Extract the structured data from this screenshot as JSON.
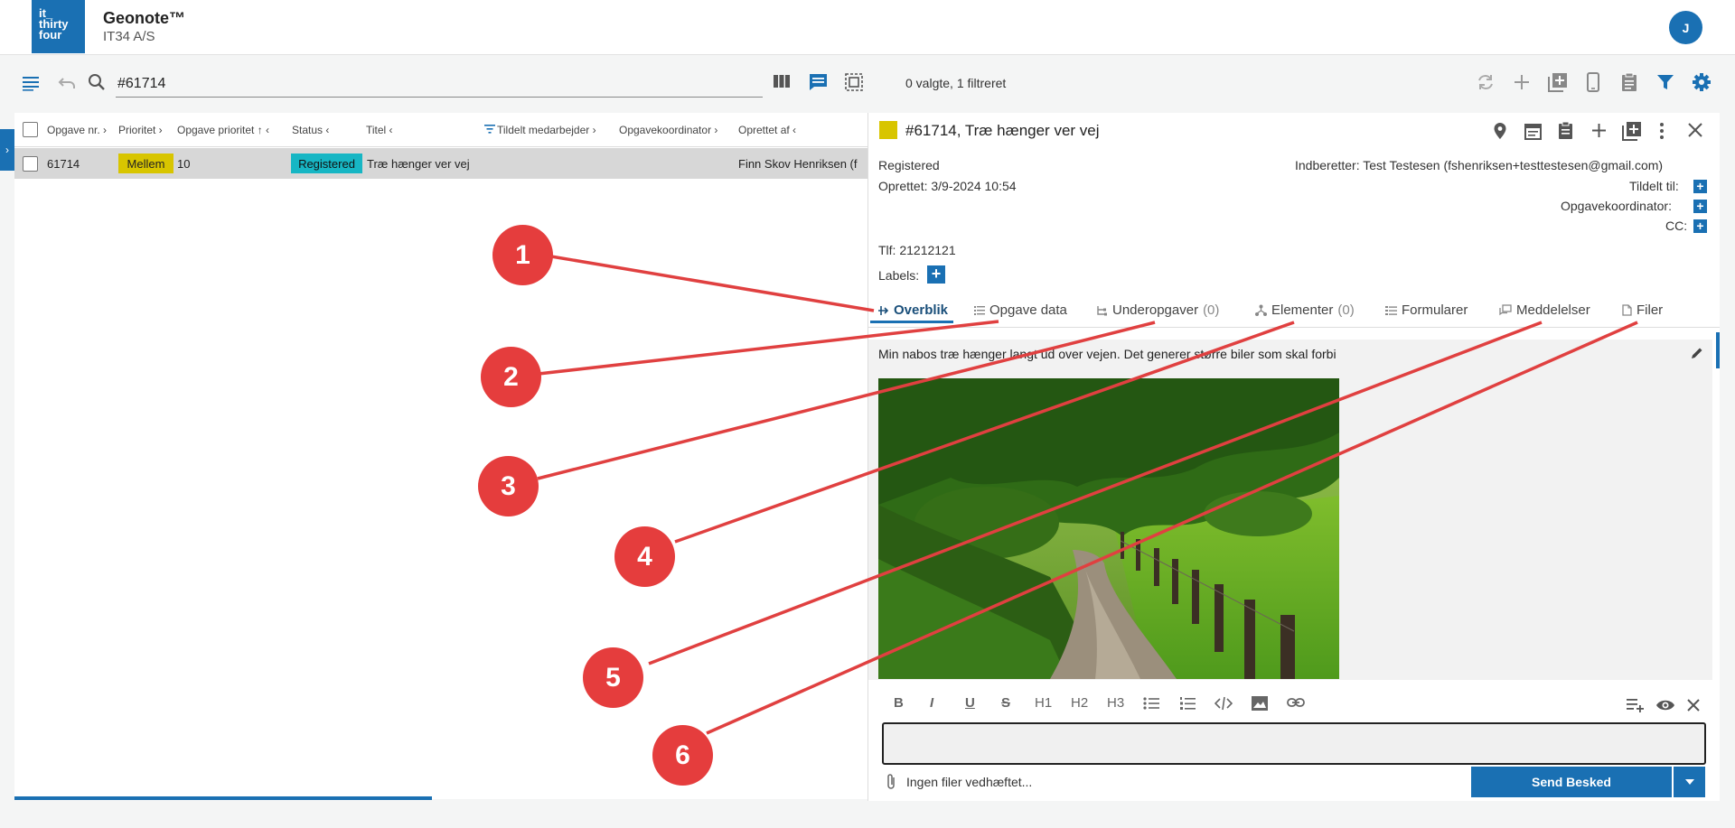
{
  "header": {
    "logo_lines": [
      "it_",
      "thirty",
      "four"
    ],
    "app_name": "Geonote™",
    "org_name": "IT34 A/S",
    "avatar_initial": "J"
  },
  "toolbar": {
    "search_value": "#61714",
    "selection_status": "0 valgte, 1 filtreret"
  },
  "table": {
    "columns": [
      "Opgave nr. ›",
      "Prioritet ›",
      "Opgave prioritet ↑ ‹",
      "Status ‹",
      "Titel ‹",
      "Tildelt medarbejder ›",
      "Opgavekoordinator ›",
      "Oprettet af ‹"
    ],
    "rows": [
      {
        "id": "61714",
        "priority": "Mellem",
        "task_priority": "10",
        "status": "Registered",
        "title": "Træ hænger ver vej",
        "created_by": "Finn Skov Henriksen (f"
      }
    ]
  },
  "detail": {
    "title": "#61714, Træ hænger ver vej",
    "status": "Registered",
    "created": "Oprettet: 3/9-2024 10:54",
    "reporter": "Indberetter: Test Testesen (fshenriksen+testtestesen@gmail.com)",
    "assigned_label": "Tildelt til:",
    "coordinator_label": "Opgavekoordinator:",
    "cc_label": "CC:",
    "phone": "Tlf: 21212121",
    "labels_label": "Labels:",
    "tabs": [
      {
        "label": "Overblik",
        "count": "",
        "icon": "overview-icon",
        "active": true
      },
      {
        "label": "Opgave data",
        "count": "",
        "icon": "list-icon"
      },
      {
        "label": "Underopgaver",
        "count": "(0)",
        "icon": "subtasks-icon"
      },
      {
        "label": "Elementer",
        "count": "(0)",
        "icon": "elements-icon"
      },
      {
        "label": "Formularer",
        "count": "",
        "icon": "forms-icon"
      },
      {
        "label": "Meddelelser",
        "count": "",
        "icon": "messages-icon"
      },
      {
        "label": "Filer",
        "count": "",
        "icon": "file-icon"
      }
    ],
    "description": "Min nabos træ hænger langt ud over vejen. Det generer større biler som skal forbi",
    "formatting": [
      "B",
      "I",
      "U",
      "S",
      "H1",
      "H2",
      "H3"
    ],
    "attach_status": "Ingen filer vedhæftet...",
    "send_label": "Send Besked"
  },
  "callouts": [
    "1",
    "2",
    "3",
    "4",
    "5",
    "6"
  ],
  "colors": {
    "primary": "#1a70b3",
    "priority_badge": "#d8c500",
    "status_badge": "#17b6c4",
    "callout": "#e53d3d",
    "callout_line": "#e04040"
  }
}
